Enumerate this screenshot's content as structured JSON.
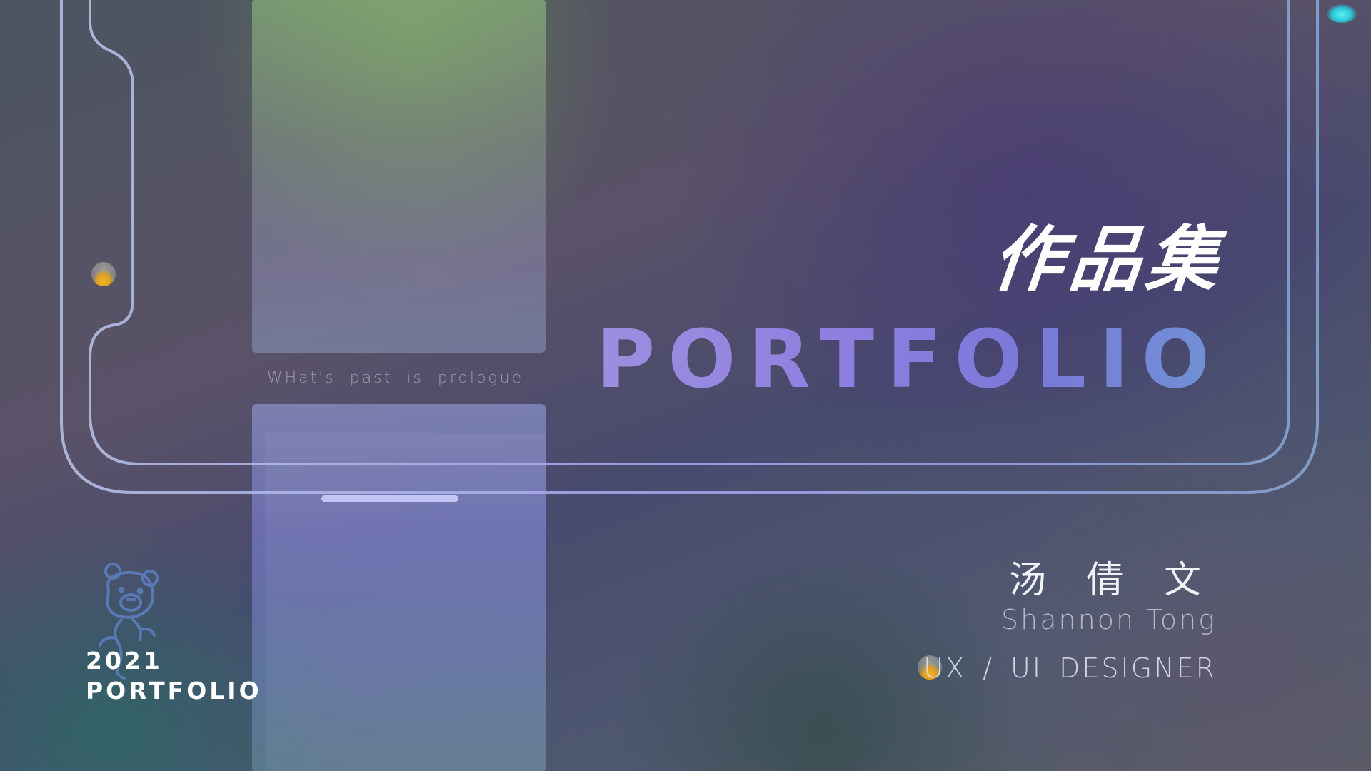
{
  "tagline": "WHat's past is prologue.",
  "title_cn": "作品集",
  "title_en": "PORTFOLIO",
  "designer": {
    "name_cn": "汤 倩 文",
    "name_en": "Shannon Tong",
    "role": "UX / UI DESIGNER"
  },
  "badge": {
    "year": "2021",
    "label": "PORTFOLIO"
  },
  "icons": {
    "mascot": "bear-mascot-icon"
  },
  "colors": {
    "title_gradient_start": "#9d8ee0",
    "title_gradient_end": "#6f92d4",
    "accent_dot": "#f2b42a",
    "accent_cyan": "#28c8d8"
  }
}
